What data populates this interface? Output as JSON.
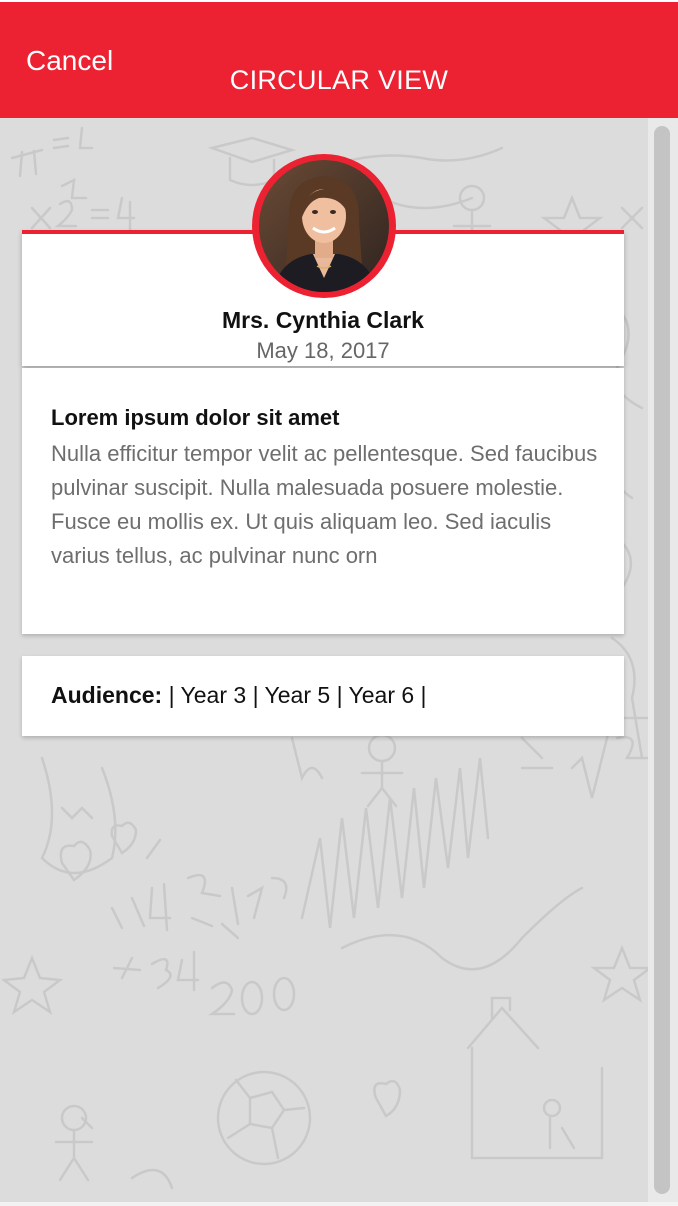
{
  "header": {
    "cancel_label": "Cancel",
    "title": "CIRCULAR VIEW",
    "color": "#ec2232"
  },
  "profile": {
    "name": "Mrs. Cynthia Clark",
    "date": "May 18, 2017",
    "avatar_icon": "person-photo"
  },
  "message": {
    "title": "Lorem ipsum dolor sit amet",
    "body": "Nulla efficitur tempor velit ac pellentesque. Sed faucibus pulvinar suscipit. Nulla malesuada posuere molestie. Fusce eu mollis ex. Ut quis aliquam leo. Sed iaculis varius tellus, ac pulvinar nunc orn"
  },
  "audience": {
    "label": "Audience:",
    "value": " | Year 3 | Year 5 | Year 6 |"
  }
}
